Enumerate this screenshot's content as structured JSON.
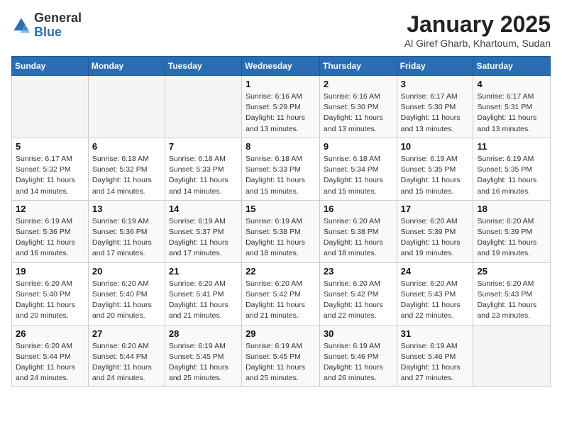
{
  "header": {
    "logo_line1": "General",
    "logo_line2": "Blue",
    "title": "January 2025",
    "subtitle": "Al Giref Gharb, Khartoum, Sudan"
  },
  "days_of_week": [
    "Sunday",
    "Monday",
    "Tuesday",
    "Wednesday",
    "Thursday",
    "Friday",
    "Saturday"
  ],
  "weeks": [
    [
      {
        "day": "",
        "sunrise": "",
        "sunset": "",
        "daylight": ""
      },
      {
        "day": "",
        "sunrise": "",
        "sunset": "",
        "daylight": ""
      },
      {
        "day": "",
        "sunrise": "",
        "sunset": "",
        "daylight": ""
      },
      {
        "day": "1",
        "sunrise": "Sunrise: 6:16 AM",
        "sunset": "Sunset: 5:29 PM",
        "daylight": "Daylight: 11 hours and 13 minutes."
      },
      {
        "day": "2",
        "sunrise": "Sunrise: 6:16 AM",
        "sunset": "Sunset: 5:30 PM",
        "daylight": "Daylight: 11 hours and 13 minutes."
      },
      {
        "day": "3",
        "sunrise": "Sunrise: 6:17 AM",
        "sunset": "Sunset: 5:30 PM",
        "daylight": "Daylight: 11 hours and 13 minutes."
      },
      {
        "day": "4",
        "sunrise": "Sunrise: 6:17 AM",
        "sunset": "Sunset: 5:31 PM",
        "daylight": "Daylight: 11 hours and 13 minutes."
      }
    ],
    [
      {
        "day": "5",
        "sunrise": "Sunrise: 6:17 AM",
        "sunset": "Sunset: 5:32 PM",
        "daylight": "Daylight: 11 hours and 14 minutes."
      },
      {
        "day": "6",
        "sunrise": "Sunrise: 6:18 AM",
        "sunset": "Sunset: 5:32 PM",
        "daylight": "Daylight: 11 hours and 14 minutes."
      },
      {
        "day": "7",
        "sunrise": "Sunrise: 6:18 AM",
        "sunset": "Sunset: 5:33 PM",
        "daylight": "Daylight: 11 hours and 14 minutes."
      },
      {
        "day": "8",
        "sunrise": "Sunrise: 6:18 AM",
        "sunset": "Sunset: 5:33 PM",
        "daylight": "Daylight: 11 hours and 15 minutes."
      },
      {
        "day": "9",
        "sunrise": "Sunrise: 6:18 AM",
        "sunset": "Sunset: 5:34 PM",
        "daylight": "Daylight: 11 hours and 15 minutes."
      },
      {
        "day": "10",
        "sunrise": "Sunrise: 6:19 AM",
        "sunset": "Sunset: 5:35 PM",
        "daylight": "Daylight: 11 hours and 15 minutes."
      },
      {
        "day": "11",
        "sunrise": "Sunrise: 6:19 AM",
        "sunset": "Sunset: 5:35 PM",
        "daylight": "Daylight: 11 hours and 16 minutes."
      }
    ],
    [
      {
        "day": "12",
        "sunrise": "Sunrise: 6:19 AM",
        "sunset": "Sunset: 5:36 PM",
        "daylight": "Daylight: 11 hours and 16 minutes."
      },
      {
        "day": "13",
        "sunrise": "Sunrise: 6:19 AM",
        "sunset": "Sunset: 5:36 PM",
        "daylight": "Daylight: 11 hours and 17 minutes."
      },
      {
        "day": "14",
        "sunrise": "Sunrise: 6:19 AM",
        "sunset": "Sunset: 5:37 PM",
        "daylight": "Daylight: 11 hours and 17 minutes."
      },
      {
        "day": "15",
        "sunrise": "Sunrise: 6:19 AM",
        "sunset": "Sunset: 5:38 PM",
        "daylight": "Daylight: 11 hours and 18 minutes."
      },
      {
        "day": "16",
        "sunrise": "Sunrise: 6:20 AM",
        "sunset": "Sunset: 5:38 PM",
        "daylight": "Daylight: 11 hours and 18 minutes."
      },
      {
        "day": "17",
        "sunrise": "Sunrise: 6:20 AM",
        "sunset": "Sunset: 5:39 PM",
        "daylight": "Daylight: 11 hours and 19 minutes."
      },
      {
        "day": "18",
        "sunrise": "Sunrise: 6:20 AM",
        "sunset": "Sunset: 5:39 PM",
        "daylight": "Daylight: 11 hours and 19 minutes."
      }
    ],
    [
      {
        "day": "19",
        "sunrise": "Sunrise: 6:20 AM",
        "sunset": "Sunset: 5:40 PM",
        "daylight": "Daylight: 11 hours and 20 minutes."
      },
      {
        "day": "20",
        "sunrise": "Sunrise: 6:20 AM",
        "sunset": "Sunset: 5:40 PM",
        "daylight": "Daylight: 11 hours and 20 minutes."
      },
      {
        "day": "21",
        "sunrise": "Sunrise: 6:20 AM",
        "sunset": "Sunset: 5:41 PM",
        "daylight": "Daylight: 11 hours and 21 minutes."
      },
      {
        "day": "22",
        "sunrise": "Sunrise: 6:20 AM",
        "sunset": "Sunset: 5:42 PM",
        "daylight": "Daylight: 11 hours and 21 minutes."
      },
      {
        "day": "23",
        "sunrise": "Sunrise: 6:20 AM",
        "sunset": "Sunset: 5:42 PM",
        "daylight": "Daylight: 11 hours and 22 minutes."
      },
      {
        "day": "24",
        "sunrise": "Sunrise: 6:20 AM",
        "sunset": "Sunset: 5:43 PM",
        "daylight": "Daylight: 11 hours and 22 minutes."
      },
      {
        "day": "25",
        "sunrise": "Sunrise: 6:20 AM",
        "sunset": "Sunset: 5:43 PM",
        "daylight": "Daylight: 11 hours and 23 minutes."
      }
    ],
    [
      {
        "day": "26",
        "sunrise": "Sunrise: 6:20 AM",
        "sunset": "Sunset: 5:44 PM",
        "daylight": "Daylight: 11 hours and 24 minutes."
      },
      {
        "day": "27",
        "sunrise": "Sunrise: 6:20 AM",
        "sunset": "Sunset: 5:44 PM",
        "daylight": "Daylight: 11 hours and 24 minutes."
      },
      {
        "day": "28",
        "sunrise": "Sunrise: 6:19 AM",
        "sunset": "Sunset: 5:45 PM",
        "daylight": "Daylight: 11 hours and 25 minutes."
      },
      {
        "day": "29",
        "sunrise": "Sunrise: 6:19 AM",
        "sunset": "Sunset: 5:45 PM",
        "daylight": "Daylight: 11 hours and 25 minutes."
      },
      {
        "day": "30",
        "sunrise": "Sunrise: 6:19 AM",
        "sunset": "Sunset: 5:46 PM",
        "daylight": "Daylight: 11 hours and 26 minutes."
      },
      {
        "day": "31",
        "sunrise": "Sunrise: 6:19 AM",
        "sunset": "Sunset: 5:46 PM",
        "daylight": "Daylight: 11 hours and 27 minutes."
      },
      {
        "day": "",
        "sunrise": "",
        "sunset": "",
        "daylight": ""
      }
    ]
  ]
}
